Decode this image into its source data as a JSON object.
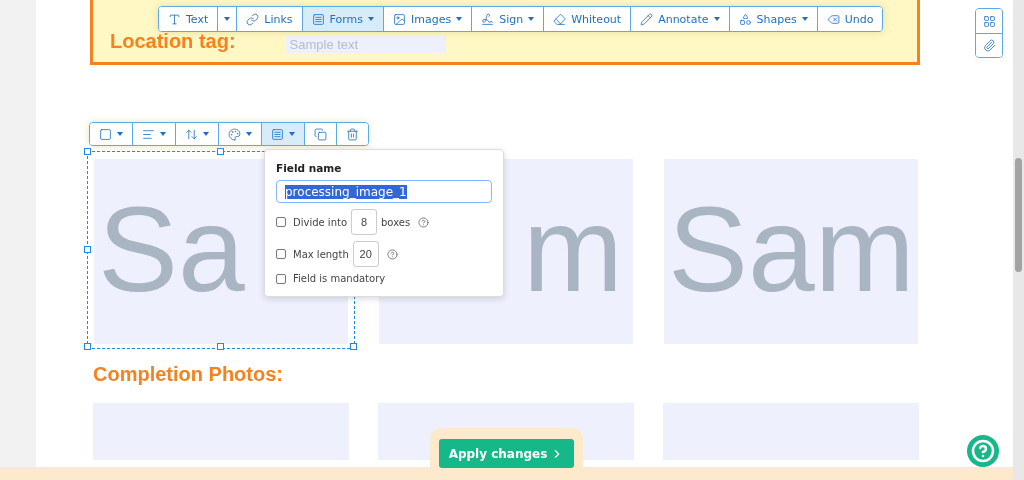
{
  "main_toolbar": [
    {
      "label": "Text",
      "dropdown": false,
      "selected": false
    },
    {
      "dropdown": true,
      "selected": false
    },
    {
      "label": "Links",
      "dropdown": false,
      "selected": false
    },
    {
      "label": "Forms",
      "dropdown": true,
      "selected": true
    },
    {
      "label": "Images",
      "dropdown": true,
      "selected": false
    },
    {
      "label": "Sign",
      "dropdown": true,
      "selected": false
    },
    {
      "label": "Whiteout",
      "dropdown": false,
      "selected": false
    },
    {
      "label": "Annotate",
      "dropdown": true,
      "selected": false
    },
    {
      "label": "Shapes",
      "dropdown": true,
      "selected": false
    },
    {
      "label": "Undo",
      "dropdown": false,
      "selected": false
    }
  ],
  "location": {
    "label": "Location tag:",
    "placeholder": "Sample text"
  },
  "element_toolbar": [
    {
      "dropdown": true,
      "selected": false
    },
    {
      "dropdown": true,
      "selected": false
    },
    {
      "dropdown": true,
      "selected": false
    },
    {
      "dropdown": true,
      "selected": false
    },
    {
      "dropdown": true,
      "selected": true
    },
    {
      "dropdown": false,
      "selected": false
    },
    {
      "dropdown": false,
      "selected": false
    }
  ],
  "processing_photos": [
    {
      "text": "Sa",
      "selected": true
    },
    {
      "text": "m",
      "selected": false
    },
    {
      "text": "Sam",
      "selected": false
    }
  ],
  "field_popover": {
    "title": "Field name",
    "value": "processing_image_1",
    "highlighted": true,
    "options": [
      {
        "label": "Divide into",
        "value": "8",
        "suffix": "boxes",
        "help": true,
        "checked": false
      },
      {
        "label": "Max length",
        "value": "20",
        "help": true,
        "checked": false
      },
      {
        "label": "Field is mandatory",
        "help": false,
        "checked": false
      }
    ]
  },
  "completion_title": "Completion Photos:",
  "apply_button": "Apply changes"
}
